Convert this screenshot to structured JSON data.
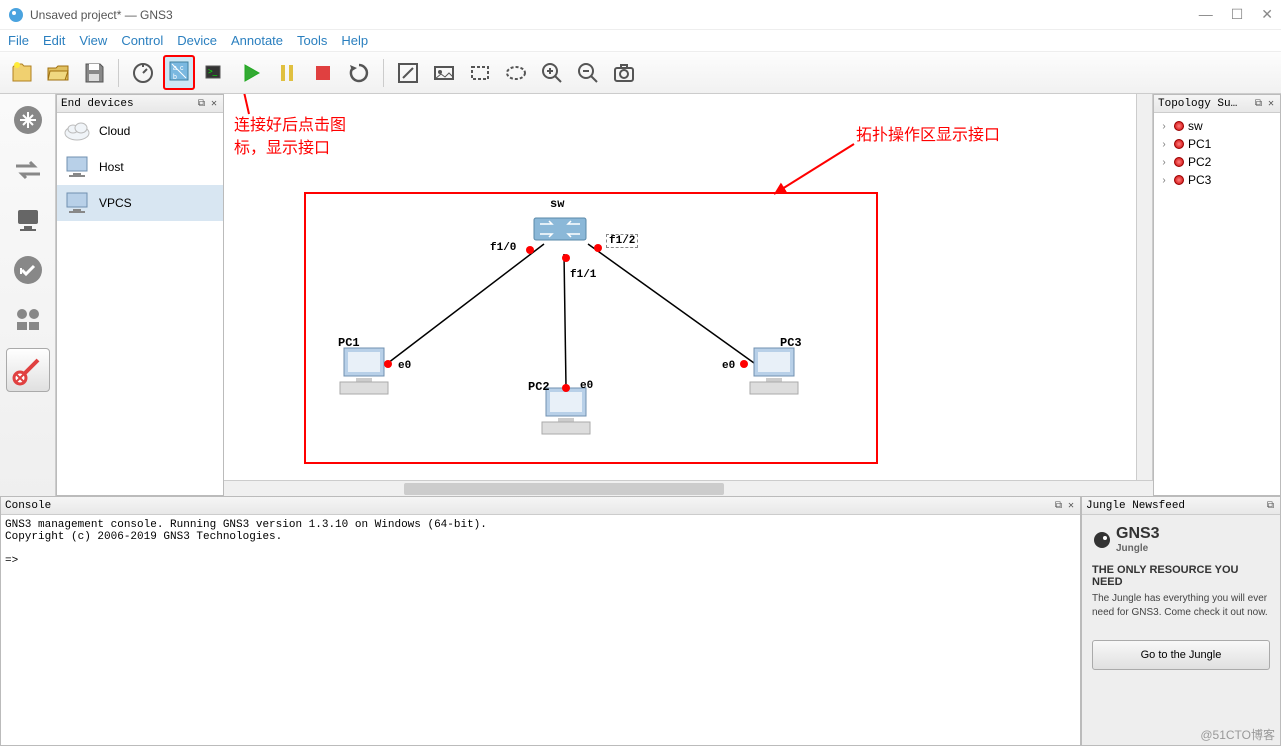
{
  "window": {
    "title": "Unsaved project* — GNS3",
    "minimize": "—",
    "maximize": "☐",
    "close": "✕"
  },
  "menu": [
    "File",
    "Edit",
    "View",
    "Control",
    "Device",
    "Annotate",
    "Tools",
    "Help"
  ],
  "panels": {
    "end_devices_title": "End devices",
    "topology_title": "Topology Su…",
    "console_title": "Console",
    "newsfeed_title": "Jungle Newsfeed"
  },
  "end_devices": [
    {
      "name": "Cloud"
    },
    {
      "name": "Host"
    },
    {
      "name": "VPCS"
    }
  ],
  "topology_tree": [
    {
      "name": "sw"
    },
    {
      "name": "PC1"
    },
    {
      "name": "PC2"
    },
    {
      "name": "PC3"
    }
  ],
  "canvas": {
    "sw": "sw",
    "pc1": "PC1",
    "pc2": "PC2",
    "pc3": "PC3",
    "f10": "f1/0",
    "f11": "f1/1",
    "f12": "f1/2",
    "e0a": "e0",
    "e0b": "e0",
    "e0c": "e0"
  },
  "annotations": {
    "left": "连接好后点击图标，显示接口",
    "right": "拓扑操作区显示接口"
  },
  "console": {
    "line1": "GNS3 management console. Running GNS3 version 1.3.10 on Windows (64-bit).",
    "line2": "Copyright (c) 2006-2019 GNS3 Technologies.",
    "prompt": "=>"
  },
  "newsfeed": {
    "logo": "GNS3",
    "logo_sub": "Jungle",
    "headline": "THE ONLY RESOURCE YOU NEED",
    "desc": "The Jungle has everything you will ever need for GNS3. Come check it out now.",
    "button": "Go to the Jungle"
  },
  "watermark": "@51CTO博客"
}
